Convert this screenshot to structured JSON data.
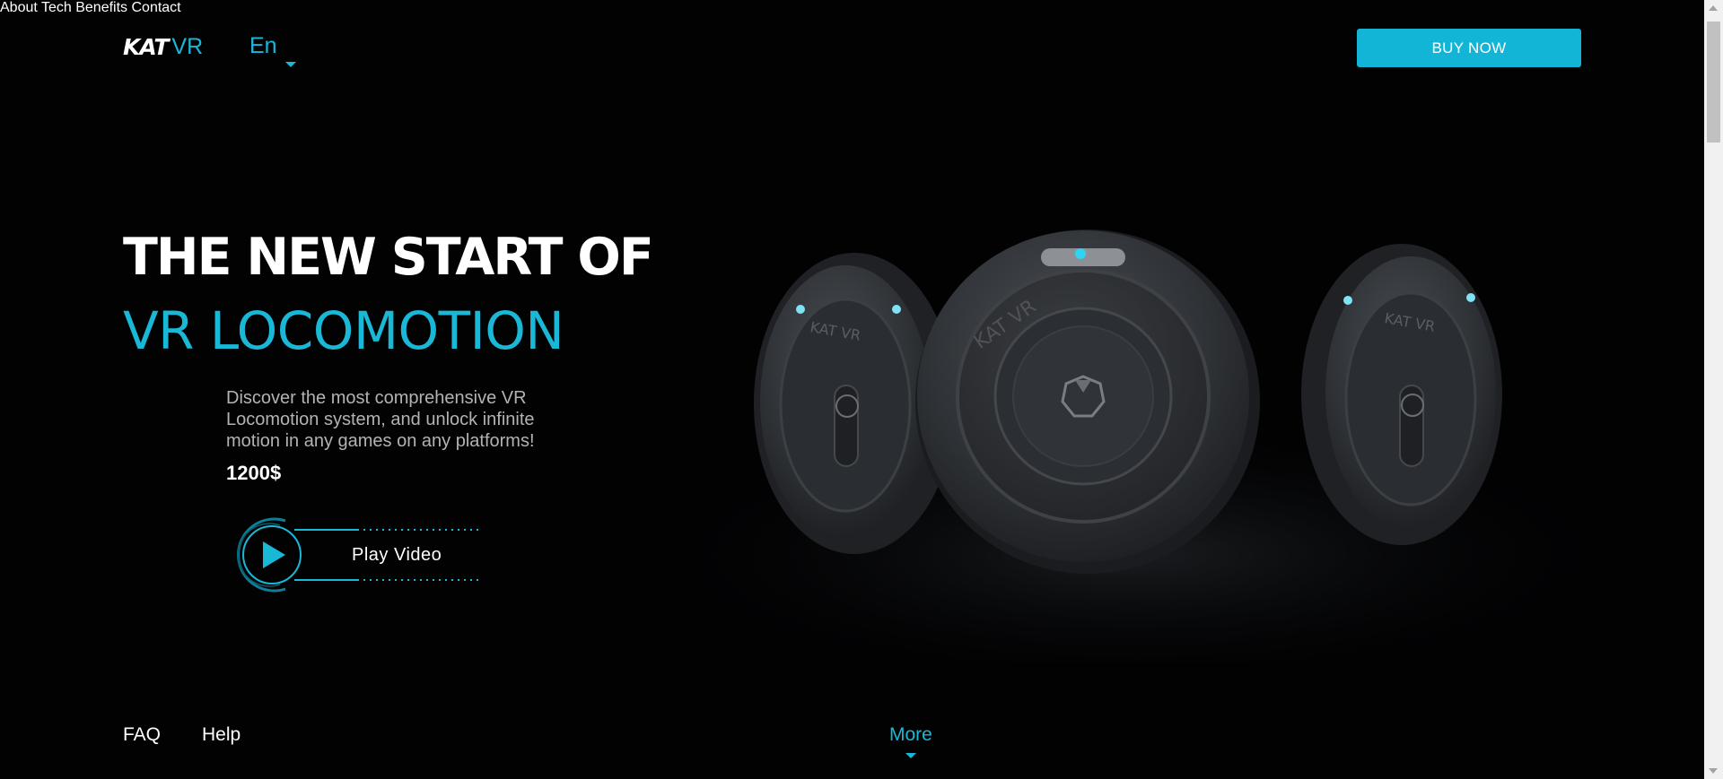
{
  "header": {
    "logo_kat": "KAT",
    "logo_vr": "VR",
    "language": "En",
    "nav": [
      "About",
      "Tech",
      "Benefits",
      "Contact"
    ],
    "buy_label": "BUY NOW"
  },
  "hero": {
    "title_line1": "THE NEW START OF",
    "title_line2": "VR LOCOMOTION",
    "description": "Discover the most comprehensive VR Locomotion system, and unlock infinite motion in any games on any platforms!",
    "price": "1200$",
    "play_label": "Play Video"
  },
  "product": {
    "brand_marks": [
      "KAT VR"
    ]
  },
  "footer_nav": {
    "faq": "FAQ",
    "help": "Help",
    "more": "More"
  },
  "colors": {
    "accent": "#19b8d6",
    "button": "#12b5d6",
    "background": "#020203"
  },
  "icons": [
    "chevron-down-icon",
    "play-icon",
    "scroll-up-icon",
    "scroll-down-icon"
  ]
}
